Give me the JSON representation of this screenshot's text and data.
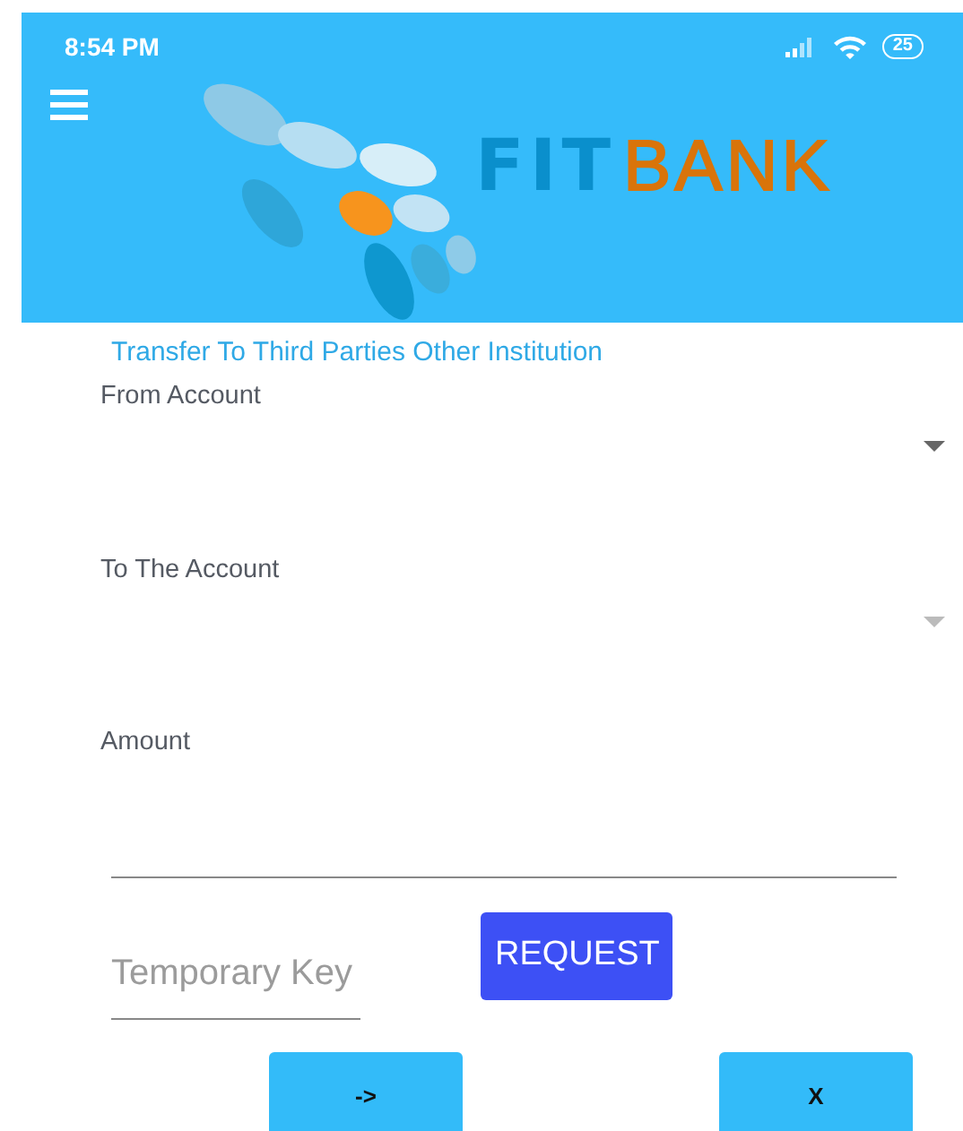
{
  "status_bar": {
    "time": "8:54 PM",
    "battery": "25"
  },
  "header": {
    "logo_left": "FIT",
    "logo_right": "BANK"
  },
  "title": "Transfer To Third Parties Other Institution",
  "dropdowns": [
    {
      "label": "From Account",
      "disabled": false
    },
    {
      "label": "To The Account",
      "disabled": true
    }
  ],
  "amount": {
    "label": "Amount"
  },
  "temporary_key": {
    "placeholder": "Temporary Key"
  },
  "request_button": "REQUEST",
  "buttons": [
    "->",
    "X"
  ]
}
